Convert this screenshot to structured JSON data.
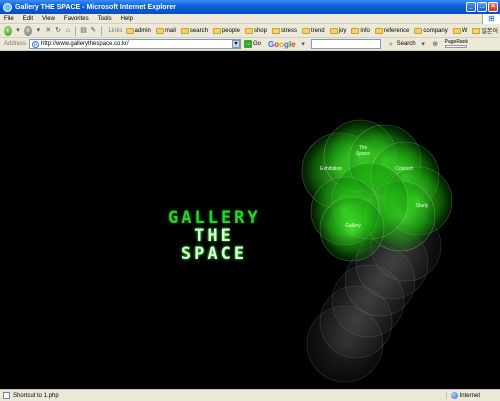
{
  "window": {
    "title": "Gallery THE SPACE - Microsoft Internet Explorer"
  },
  "menu": {
    "items": [
      "File",
      "Edit",
      "View",
      "Favorites",
      "Tools",
      "Help"
    ]
  },
  "toolbar": {
    "links_label": "Links",
    "links": [
      "admin",
      "mail",
      "search",
      "people",
      "shop",
      "stress",
      "trend",
      "joy",
      "info",
      "reference",
      "company",
      "W",
      "일본어"
    ]
  },
  "address": {
    "label": "Address",
    "url": "http://www.gallerythespace.co.kr/",
    "go_label": "Go",
    "search_label": "Search",
    "pagerank_label": "PageRank"
  },
  "page": {
    "logo_line1": "GALLERY",
    "logo_line2": "THE",
    "logo_line3": "SPACE",
    "menu_labels": {
      "the_space": [
        "The",
        "Space"
      ],
      "exhibition": "Exhibition",
      "concert": "Concert",
      "study": "Study",
      "gallery": "Gallery"
    }
  },
  "status": {
    "text": "Shortcut to 1.php",
    "zone": "Internet"
  },
  "colors": {
    "accent_green": "#2ecf2e",
    "background": "#000000"
  }
}
